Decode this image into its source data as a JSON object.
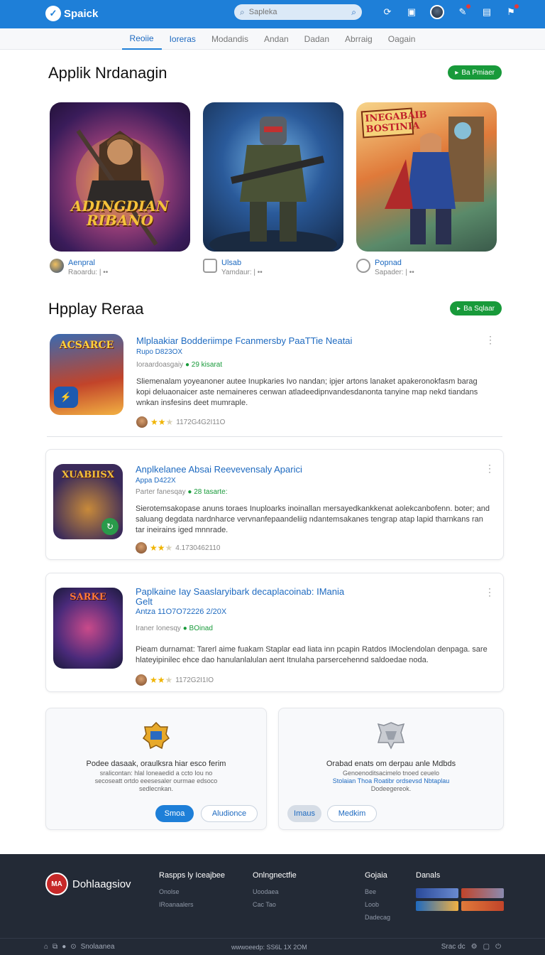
{
  "topbar": {
    "app_name": "Spaick",
    "search_placeholder": "Sapleka"
  },
  "tabs": [
    "Reoiie",
    "Ioreras",
    "Modandis",
    "Andan",
    "Dadan",
    "Abrraig",
    "Oagain"
  ],
  "section1": {
    "title": "Applik Nrdanagin",
    "button": "Ba Pmiaer",
    "cards": [
      {
        "art_text": "ADINGDIAN RIBANO",
        "name": "Aenpral",
        "sub": "Raoardu: | ••"
      },
      {
        "art_text": "",
        "name": "Ulsab",
        "sub": "Yamdaur: | ••"
      },
      {
        "art_text": "INEGABAIB BOSTINIA",
        "name": "Popnad",
        "sub": "Sapader: | ••"
      }
    ]
  },
  "section2": {
    "title": "Hpplay Reraa",
    "button": "Ba Sqlaar",
    "items": [
      {
        "thumb_text": "ACSARCE",
        "title": "Mlplaakiar Bodderiimpe Fcanmersby PaaTTie Neatai",
        "line2": "Rupo D823OX",
        "meta": "Ioraardoasgaiy",
        "meta_green": "29 kisarat",
        "desc": "Sliemenalam yoyeanoner autee Inupkaries Ivo nandan; ipjer artons lanaket apakeronokfasm barag kopi deluaonaicer aste nemaineres cenwan atladeedipnvandesdanonta tanyine map nekd tiandans wnkan insfesins deet mumraple.",
        "rating_count": "1172G4G2I11O"
      },
      {
        "thumb_text": "XUABIISX",
        "title": "Anplkelanee Absai Reevevensaly Aparici",
        "line2": "Appa D422X",
        "meta": "Parter fanesqay",
        "meta_green": "28 tasarte:",
        "desc": "Sierotemsakopase anuns toraes Inuploarks inoinallan mersayedkankkenat aolekcanbofenn. boter; and saluang degdata nardnharce vervnanfepaandeliig ndantemsakanes tengrap atap lapid tharnkans ran tar ineirains iged mnnrade.",
        "rating_count": "4.1730462110"
      },
      {
        "thumb_text": "SARKE",
        "title": "Paplkaine Iay Saaslaryibark decaplacoinab: IMania",
        "title2": "Gelt",
        "line2": "Antza 11O7O72226 2/20X",
        "meta": "Iraner Ionesqy",
        "meta_green": "BOinad",
        "desc": "Pieam durnamat: Tarerl aime fuakam Staplar ead liata inn pcapin Ratdos IMoclendolan denpaga. sare hlateyipinilec ehce dao hanulanlalulan aent Itnulaha parsercehennd saldoedae noda.",
        "rating_count": "1172G2I1IO"
      }
    ]
  },
  "promos": [
    {
      "heading": "Podee dasaak, oraulksra hiar esco ferim",
      "text": "sralicontan: hlal Ioneaedid a ccto Iou no secoseatt ortdo eeesesaler ourmae edsoco sedlecnkan.",
      "btn_primary": "Smoa",
      "btn_secondary": "Aludionce"
    },
    {
      "heading": "Orabad enats om derpau anle Mdbds",
      "text": "Genoenoditsacimelo tnoed ceuelo",
      "text_blue": "Stolaian Thoa Roatibr ordsevsd Nbtaplau",
      "text_end": "Dodeegereok.",
      "btn_primary": "Imaus",
      "btn_secondary": "Medkim"
    }
  ],
  "footer": {
    "brand": "Dohlaagsiov",
    "col1_title": "Raspps ly Iceajbee",
    "col1_links": [
      "Onolse",
      "IRoanaalers"
    ],
    "col2_title": "Onlngnectfie",
    "col2_links": [
      "Uoodaea",
      "Cac Tao"
    ],
    "col3_title": "Gojaia",
    "col3_links": [
      "Bee",
      "Loob",
      "Dadecag"
    ],
    "col4_title": "Danals",
    "bottom_left": "Snolaanea",
    "bottom_mid": "wwwoeedp: SS6L 1X 2OM",
    "bottom_right": "Srac dc"
  }
}
